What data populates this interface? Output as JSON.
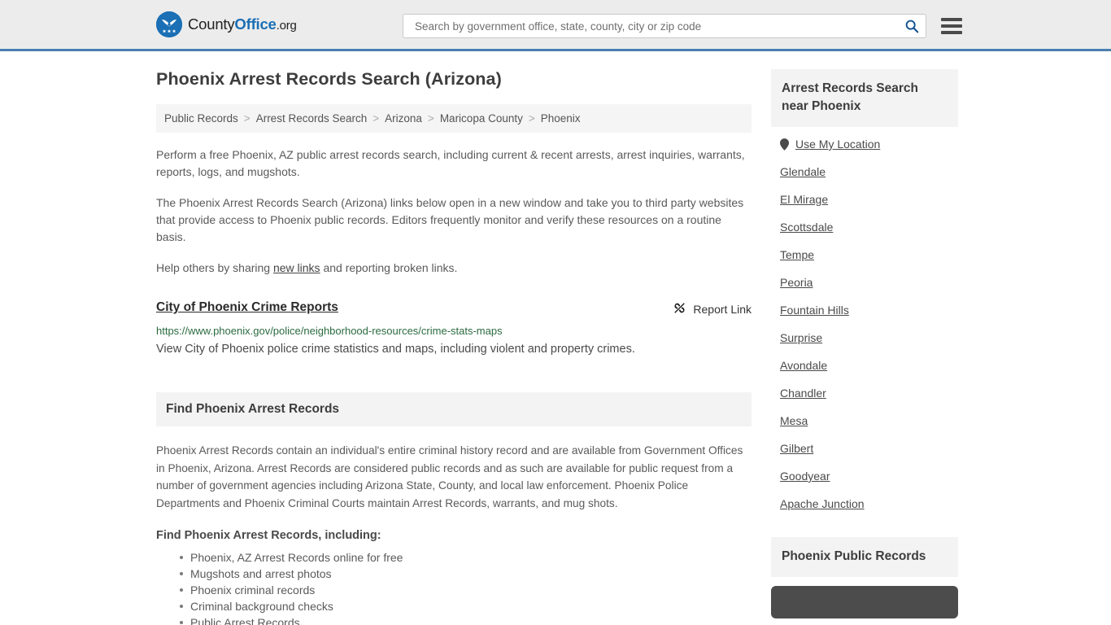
{
  "header": {
    "logo": {
      "part1": "County",
      "part2": "Office",
      "part3": ".org",
      "icon": "eagle-seal-logo"
    },
    "search": {
      "placeholder": "Search by government office, state, county, city or zip code",
      "value": "",
      "icon": "search-icon"
    },
    "menu_icon": "hamburger-menu-icon",
    "accent_color": "#1a6fb5",
    "border_color": "#4a7faf"
  },
  "main": {
    "title": "Phoenix Arrest Records Search (Arizona)",
    "breadcrumb": [
      {
        "label": "Public Records",
        "current": false
      },
      {
        "label": "Arrest Records Search",
        "current": false
      },
      {
        "label": "Arizona",
        "current": false
      },
      {
        "label": "Maricopa County",
        "current": false
      },
      {
        "label": "Phoenix",
        "current": true
      }
    ],
    "breadcrumb_separator": ">",
    "intro": {
      "para1": "Perform a free Phoenix, AZ public arrest records search, including current & recent arrests, arrest inquiries, warrants, reports, logs, and mugshots.",
      "para2": "The Phoenix Arrest Records Search (Arizona) links below open in a new window and take you to third party websites that provide access to Phoenix public records. Editors frequently monitor and verify these resources on a routine basis.",
      "para3_before": "Help others by sharing ",
      "para3_link": "new links",
      "para3_after": " and reporting broken links."
    },
    "result": {
      "title": "City of Phoenix Crime Reports",
      "url": "https://www.phoenix.gov/police/neighborhood-resources/crime-stats-maps",
      "description": "View City of Phoenix police crime statistics and maps, including violent and property crimes.",
      "report_label": "Report Link",
      "report_icon": "broken-link-icon",
      "url_color": "#2b6b3f"
    },
    "section": {
      "heading": "Find Phoenix Arrest Records",
      "body": "Phoenix Arrest Records contain an individual's entire criminal history record and are available from Government Offices in Phoenix, Arizona. Arrest Records are considered public records and as such are available for public request from a number of government agencies including Arizona State, County, and local law enforcement. Phoenix Police Departments and Phoenix Criminal Courts maintain Arrest Records, warrants, and mug shots.",
      "sub_heading": "Find Phoenix Arrest Records, including:",
      "bullets": [
        "Phoenix, AZ Arrest Records online for free",
        "Mugshots and arrest photos",
        "Phoenix criminal records",
        "Criminal background checks",
        "Public Arrest Records"
      ]
    }
  },
  "sidebar": {
    "heading": "Arrest Records Search near Phoenix",
    "use_my_location": {
      "label": "Use My Location",
      "icon": "map-pin-icon"
    },
    "cities": [
      "Glendale",
      "El Mirage",
      "Scottsdale",
      "Tempe",
      "Peoria",
      "Fountain Hills",
      "Surprise",
      "Avondale",
      "Chandler",
      "Mesa",
      "Gilbert",
      "Goodyear",
      "Apache Junction"
    ],
    "second_heading": "Phoenix Public Records"
  }
}
